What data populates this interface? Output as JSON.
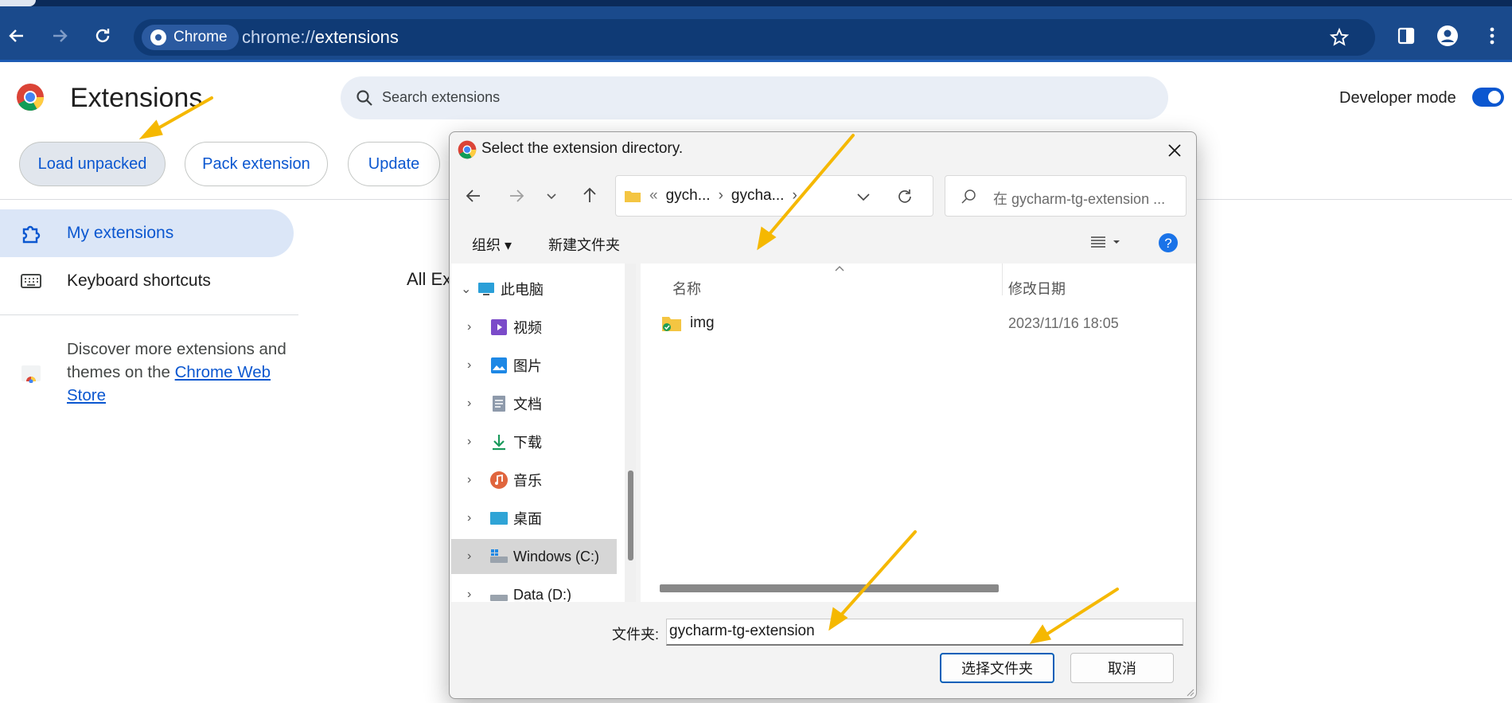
{
  "browser": {
    "chip_label": "Chrome",
    "url_prefix": "chrome://",
    "url_path": "extensions"
  },
  "page": {
    "title": "Extensions",
    "search_placeholder": "Search extensions",
    "developer_mode_label": "Developer mode",
    "developer_mode_on": true,
    "buttons": {
      "load_unpacked": "Load unpacked",
      "pack_extension": "Pack extension",
      "update": "Update"
    },
    "nav": {
      "my_extensions": "My extensions",
      "keyboard_shortcuts": "Keyboard shortcuts"
    },
    "discover_text": "Discover more extensions and themes on the ",
    "store_link": "Chrome Web Store",
    "all_extensions_partial": "All Ex"
  },
  "dialog": {
    "title": "Select the extension directory.",
    "breadcrumb": [
      "gych...",
      "gycha..."
    ],
    "search_placeholder": "在 gycharm-tg-extension ...",
    "cmd_organize": "组织",
    "cmd_new_folder": "新建文件夹",
    "tree": [
      {
        "label": "此电脑",
        "icon": "computer-icon",
        "level": 0,
        "expanded": true
      },
      {
        "label": "视频",
        "icon": "videos-icon",
        "level": 1
      },
      {
        "label": "图片",
        "icon": "pictures-icon",
        "level": 1
      },
      {
        "label": "文档",
        "icon": "documents-icon",
        "level": 1
      },
      {
        "label": "下载",
        "icon": "downloads-icon",
        "level": 1
      },
      {
        "label": "音乐",
        "icon": "music-icon",
        "level": 1
      },
      {
        "label": "桌面",
        "icon": "desktop-icon",
        "level": 1
      },
      {
        "label": "Windows (C:)",
        "icon": "drive-icon",
        "level": 1,
        "selected": true
      },
      {
        "label": "Data (D:)",
        "icon": "drive-icon",
        "level": 1
      }
    ],
    "columns": {
      "name": "名称",
      "modified": "修改日期"
    },
    "files": [
      {
        "name": "img",
        "modified": "2023/11/16 18:05",
        "icon": "folder-icon"
      }
    ],
    "folder_label": "文件夹:",
    "folder_value": "gycharm-tg-extension",
    "select_button": "选择文件夹",
    "cancel_button": "取消"
  },
  "colors": {
    "accent": "#0b57d0",
    "toolbar": "#1a4a8c",
    "annotation_arrow": "#f5b800"
  }
}
